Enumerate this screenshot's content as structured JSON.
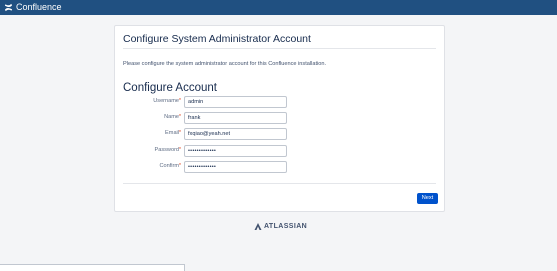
{
  "topbar": {
    "app_name": "Confluence",
    "logo_icon": "confluence-logo-icon",
    "background_color": "#205081"
  },
  "card": {
    "title": "Configure System Administrator Account",
    "intro": "Please configure the system administrator account for this Confluence installation.",
    "section_title": "Configure Account",
    "fields": [
      {
        "label": "Username",
        "value": "admin",
        "type": "text"
      },
      {
        "label": "Name",
        "value": "frank",
        "type": "text"
      },
      {
        "label": "Email",
        "value": "fxqiao@yeah.net",
        "type": "email"
      },
      {
        "label": "Password",
        "value": "•••••••••••••",
        "type": "password"
      },
      {
        "label": "Confirm",
        "value": "•••••••••••••",
        "type": "password"
      }
    ],
    "required_marker": "*",
    "next_label": "Next",
    "next_color": "#0052cc"
  },
  "footer": {
    "brand": "ATLASSIAN",
    "brand_icon": "atlassian-logo-icon"
  }
}
